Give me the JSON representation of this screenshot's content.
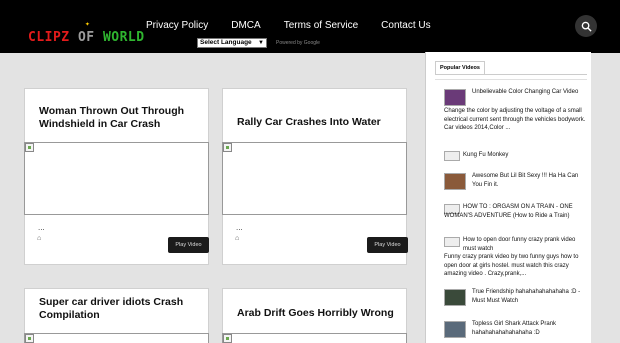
{
  "header": {
    "logo": {
      "word1": "CLIPZ",
      "word2": "OF",
      "word3": "WORLD"
    },
    "nav": [
      "Privacy Policy",
      "DMCA",
      "Terms of Service",
      "Contact Us"
    ],
    "language_select": "Select Language",
    "powered_by": "Powered by Google"
  },
  "posts": [
    {
      "title": "Woman Thrown Out Through Windshield in Car Crash",
      "excerpt": "...",
      "play_label": "Play Video"
    },
    {
      "title": "Rally Car Crashes Into Water",
      "excerpt": "...",
      "play_label": "Play Video"
    },
    {
      "title": "Super car driver idiots Crash Compilation"
    },
    {
      "title": "Arab Drift Goes Horribly Wrong"
    }
  ],
  "sidebar": {
    "tab_label": "Popular Videos",
    "items": [
      {
        "title": "Unbelievable Color Changing Car Video",
        "snippet": "Change the color by adjusting the voltage of a small electrical current sent through the vehicles bodywork. Car videos 2014,Color ..."
      },
      {
        "title": "Kung Fu Monkey",
        "snippet": ""
      },
      {
        "title": "Awesome But Lil Bit Sexy !!! Ha Ha Can You Fin it.",
        "snippet": ""
      },
      {
        "title": "HOW TO : ORGASM ON A TRAIN - ONE WOMAN'S ADVENTURE (How to Ride a Train)",
        "snippet": ""
      },
      {
        "title": "How to open door funny crazy prank video must watch",
        "snippet": "Funny crazy prank video by two funny guys how to open door at girls hostel. must watch this crazy amazing video . Crazy,prank,..."
      },
      {
        "title": "True Friendship hahahahahahahaha :D - Must Must Watch",
        "snippet": ""
      },
      {
        "title": "Topless Girl Shark Attack Prank hahahahahahahahaha :D",
        "snippet": ""
      }
    ]
  }
}
